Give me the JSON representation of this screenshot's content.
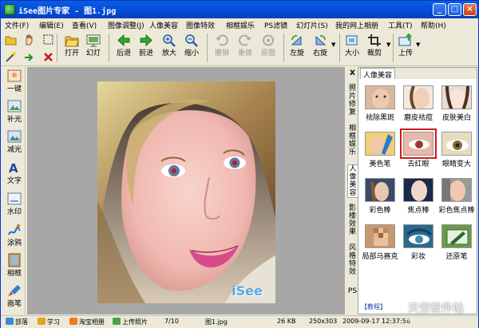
{
  "title": "iSee图片专家 - 图1.jpg",
  "colors": {
    "titlebar": "#0551e0",
    "accent_red": "#d01a1a",
    "viewer_bg": "#a7a7a7"
  },
  "menu": [
    "文件(F)",
    "编辑(E)",
    "查看(V)",
    "图像调整(J)",
    "人像美容",
    "图像特效",
    "相框娱乐",
    "PS滤镜",
    "幻灯片(S)",
    "我的网上相册",
    "工具(T)",
    "帮助(H)"
  ],
  "toolbar": {
    "open": "打开",
    "slideshow": "幻灯",
    "back": "后退",
    "forward": "前进",
    "zoom_in": "放大",
    "zoom_out": "缩小",
    "undo": "撤销",
    "redo": "重做",
    "reset": "原图",
    "rotate_left": "左旋",
    "rotate_right": "右旋",
    "resize": "大小",
    "crop": "裁剪",
    "upload": "上传"
  },
  "lefttools": [
    "一键",
    "补光",
    "减光",
    "文字",
    "水印",
    "涂鸦",
    "相框",
    "画笔"
  ],
  "sidetabs": {
    "close": "X",
    "photo_repair": "照片修复",
    "frame_fun": "相框娱乐",
    "portrait": "人像美容",
    "film": "影楼效果",
    "style": "风格特效",
    "ps": "PS"
  },
  "panel": {
    "tab_title": "人像美容",
    "effects": [
      {
        "label": "祛除黑斑",
        "icon": "freckle-remove-icon"
      },
      {
        "label": "磨皮祛痘",
        "icon": "skin-smooth-icon"
      },
      {
        "label": "皮肤美白",
        "icon": "skin-whiten-icon"
      },
      {
        "label": "美色笔",
        "icon": "color-pen-icon"
      },
      {
        "label": "去红眼",
        "icon": "red-eye-icon",
        "selected": true
      },
      {
        "label": "眼睛变大",
        "icon": "eye-enlarge-icon"
      },
      {
        "label": "彩色棒",
        "icon": "color-wand-icon"
      },
      {
        "label": "焦点棒",
        "icon": "focus-wand-icon"
      },
      {
        "label": "彩色焦点棒",
        "icon": "color-focus-icon"
      },
      {
        "label": "局部马赛克",
        "icon": "mosaic-icon"
      },
      {
        "label": "彩妆",
        "icon": "makeup-icon"
      },
      {
        "label": "还原笔",
        "icon": "restore-pen-icon"
      }
    ],
    "tutorial": "【教程】"
  },
  "photo_logo": "iSee",
  "status": {
    "buttons": [
      "部落",
      "学习",
      "淘宝相册",
      "上传照片"
    ],
    "page": "7/10",
    "file": "图1.jpg",
    "size": "26 KB",
    "dims": "250x303",
    "date": "2009-09-17  12:37:56"
  },
  "watermark": {
    "main": "天空软件站",
    "url": "www.skycn.com"
  }
}
